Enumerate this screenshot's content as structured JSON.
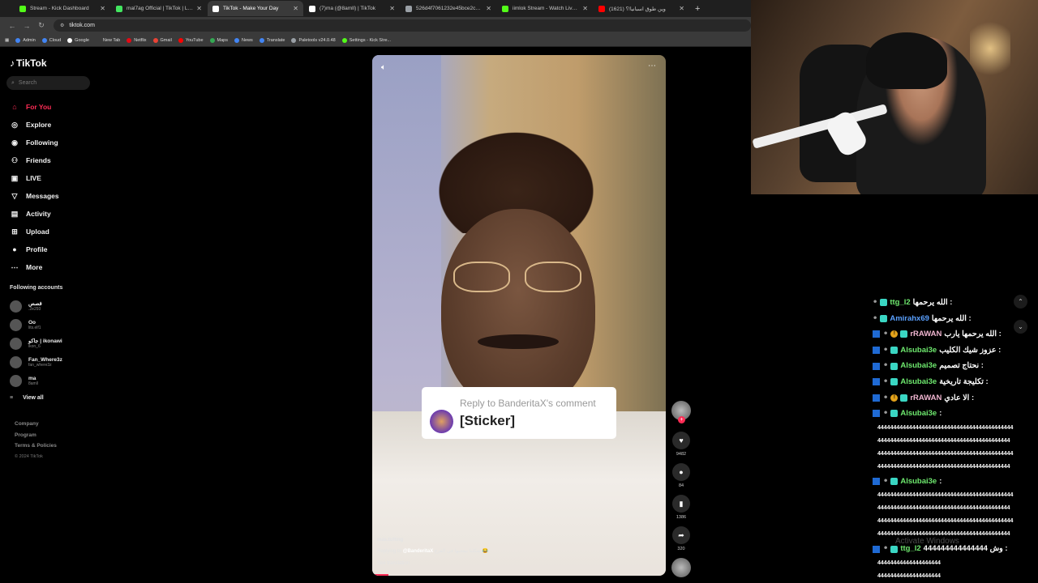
{
  "browser": {
    "tabs": [
      {
        "title": "Stream - Kick Dashboard",
        "color": "#53fc18"
      },
      {
        "title": "mal7ag Official | TikTok | Linktr",
        "color": "#43e660"
      },
      {
        "title": "TikTok - Make Your Day",
        "color": "#ffffff"
      },
      {
        "title": "(7)ma (@8amll) | TikTok",
        "color": "#ffffff"
      },
      {
        "title": "526d4f7061232e45bce2cacd51...",
        "color": "#9aa0a6"
      },
      {
        "title": "iimlok Stream - Watch Live on",
        "color": "#53fc18"
      },
      {
        "title": "وين طوق اسبانيا!؟ (1621)",
        "color": "#ff0000"
      }
    ],
    "new_tab": "+",
    "url": "tiktok.com",
    "bookmarks": [
      {
        "label": "Admin",
        "color": "#4285f4"
      },
      {
        "label": "Cloud",
        "color": "#4285f4"
      },
      {
        "label": "Google",
        "color": "#ffffff"
      },
      {
        "label": "New Tab",
        "color": "#3a3a3a"
      },
      {
        "label": "Netflix",
        "color": "#e50914"
      },
      {
        "label": "Gmail",
        "color": "#ea4335"
      },
      {
        "label": "YouTube",
        "color": "#ff0000"
      },
      {
        "label": "Maps",
        "color": "#34a853"
      },
      {
        "label": "News",
        "color": "#4285f4"
      },
      {
        "label": "Translate",
        "color": "#4285f4"
      },
      {
        "label": "Paletools v24.0.48",
        "color": "#9aa0a6"
      },
      {
        "label": "Settings - Kick Stre...",
        "color": "#53fc18"
      }
    ]
  },
  "tiktok": {
    "logo": "TikTok",
    "search_placeholder": "Search",
    "nav": [
      {
        "label": "For You",
        "icon": "home-icon",
        "glyph": "⌂",
        "active": true
      },
      {
        "label": "Explore",
        "icon": "compass-icon",
        "glyph": "◎"
      },
      {
        "label": "Following",
        "icon": "following-icon",
        "glyph": "◉"
      },
      {
        "label": "Friends",
        "icon": "friends-icon",
        "glyph": "⚇"
      },
      {
        "label": "LIVE",
        "icon": "live-icon",
        "glyph": "▣"
      },
      {
        "label": "Messages",
        "icon": "messages-icon",
        "glyph": "▽"
      },
      {
        "label": "Activity",
        "icon": "activity-icon",
        "glyph": "▤"
      },
      {
        "label": "Upload",
        "icon": "upload-icon",
        "glyph": "⊞"
      },
      {
        "label": "Profile",
        "icon": "profile-icon",
        "glyph": "●"
      },
      {
        "label": "More",
        "icon": "more-icon",
        "glyph": "⋯"
      }
    ],
    "following_header": "Following accounts",
    "following": [
      {
        "name": "قصص",
        "handle": ".2e293"
      },
      {
        "name": "Oo",
        "handle": "lits.elf1"
      },
      {
        "name": "جاكو | ikonawi",
        "handle": "ikon_6"
      },
      {
        "name": "Fan_Where3z",
        "handle": "fan_where3z"
      },
      {
        "name": "ma",
        "handle": "8amll"
      }
    ],
    "view_all": "View all",
    "footer": [
      "Company",
      "Program",
      "Terms & Policies"
    ],
    "copyright": "© 2024 TikTok"
  },
  "video": {
    "reply_title": "Reply to BanderitaX's comment",
    "reply_body": "[Sticker]",
    "username": "mas.tufting",
    "replying_prefix": "Replying to ",
    "replying_mention": "@BanderitaX",
    "caption": " شكلنا بيعجبها في الفرع 😂",
    "see_translation": "See translation",
    "stats": {
      "likes": "9482",
      "comments": "84",
      "saves": "1386",
      "shares": "320"
    }
  },
  "chat": {
    "messages": [
      {
        "user": "ttg_l2",
        "color": "#6ee86e",
        "text": "الله يرحمها :",
        "kick": false,
        "sub": false
      },
      {
        "user": "Amirahx69",
        "color": "#5aa0ff",
        "text": "الله يرحمها :",
        "kick": false,
        "sub": false
      },
      {
        "user": "rRAWAN",
        "color": "#f0b5d0",
        "text": "الله يرحمها يارب :",
        "kick": true,
        "sub": true
      },
      {
        "user": "Alsubai3e",
        "color": "#6ee86e",
        "text": "عزوز شيك الكليب :",
        "kick": true,
        "sub": false
      },
      {
        "user": "Alsubai3e",
        "color": "#6ee86e",
        "text": "نحتاج تصميم :",
        "kick": true,
        "sub": false
      },
      {
        "user": "Alsubai3e",
        "color": "#6ee86e",
        "text": "تكليجة تاريخية :",
        "kick": true,
        "sub": false
      },
      {
        "user": "rRAWAN",
        "color": "#f0b5d0",
        "text": "الا عادي :",
        "kick": true,
        "sub": true
      },
      {
        "user": "Alsubai3e",
        "color": "#6ee86e",
        "text": ":",
        "kick": true,
        "sub": false
      },
      {
        "user": "Alsubai3e",
        "color": "#6ee86e",
        "text": ":",
        "kick": true,
        "sub": false
      },
      {
        "user": "ttg_l2",
        "color": "#6ee86e",
        "text": "وش 444444444444444 :",
        "kick": true,
        "sub": false
      }
    ],
    "spam_a": "4444444444444444444444444444444444444444444",
    "spam_b": "444444444444444444444444444444444444444444",
    "spam_short": "44444444444444444444",
    "watermark": "Activate Windows"
  }
}
